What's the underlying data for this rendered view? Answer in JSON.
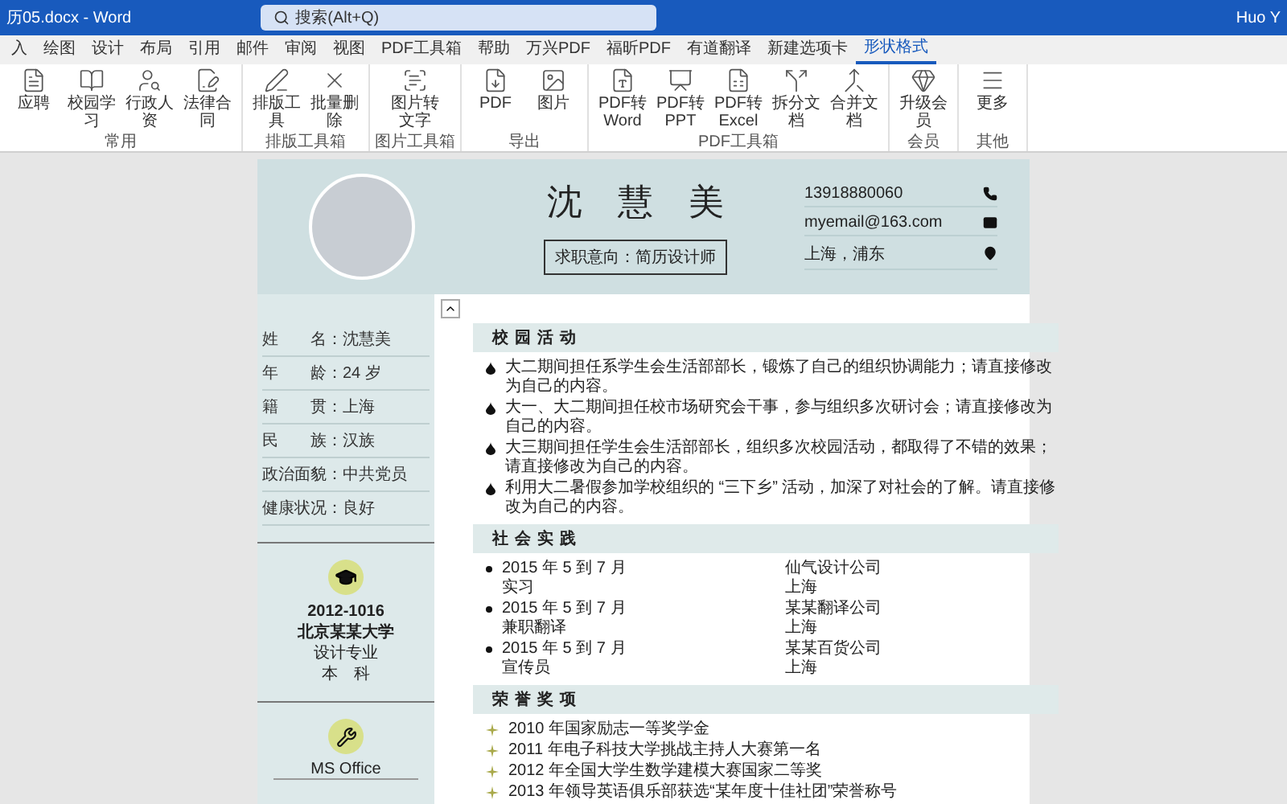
{
  "window": {
    "title": "历05.docx - Word",
    "search_placeholder": "搜索(Alt+Q)",
    "user": "Huo Y"
  },
  "tabs": [
    {
      "label": "入",
      "selected": false
    },
    {
      "label": "绘图",
      "selected": false
    },
    {
      "label": "设计",
      "selected": false
    },
    {
      "label": "布局",
      "selected": false
    },
    {
      "label": "引用",
      "selected": false
    },
    {
      "label": "邮件",
      "selected": false
    },
    {
      "label": "审阅",
      "selected": false
    },
    {
      "label": "视图",
      "selected": false
    },
    {
      "label": "PDF工具箱",
      "selected": false
    },
    {
      "label": "帮助",
      "selected": false
    },
    {
      "label": "万兴PDF",
      "selected": false
    },
    {
      "label": "福昕PDF",
      "selected": false
    },
    {
      "label": "有道翻译",
      "selected": false
    },
    {
      "label": "新建选项卡",
      "selected": false
    },
    {
      "label": "形状格式",
      "selected": true
    }
  ],
  "ribbon_groups": [
    {
      "label": "常用",
      "buttons": [
        "应聘",
        "校园学习",
        "行政人资",
        "法律合同"
      ]
    },
    {
      "label": "排版工具箱",
      "buttons": [
        "排版工具",
        "批量删除"
      ]
    },
    {
      "label": "图片工具箱",
      "buttons": [
        "图片转文字"
      ]
    },
    {
      "label": "导出",
      "buttons": [
        "PDF",
        "图片"
      ]
    },
    {
      "label": "PDF工具箱",
      "buttons": [
        "PDF转Word",
        "PDF转PPT",
        "PDF转Excel",
        "拆分文档",
        "合并文档"
      ]
    },
    {
      "label": "会员",
      "buttons": [
        "升级会员"
      ]
    },
    {
      "label": "其他",
      "buttons": [
        "更多"
      ]
    }
  ],
  "resume": {
    "name": "沈慧美",
    "objective": "求职意向：简历设计师",
    "contacts": [
      "13918880060",
      "myemail@163.com",
      "上海，浦东"
    ],
    "profile": [
      "姓　　名：沈慧美",
      "年　　龄：24 岁",
      "籍　　贯：上海",
      "民　　族：汉族",
      "政治面貌：中共党员",
      "健康状况：良好"
    ],
    "education": {
      "years": "2012-1016",
      "school": "北京某某大学",
      "major": "设计专业",
      "degree": "本　科"
    },
    "skills": [
      "MS Office"
    ],
    "campus": {
      "title": "校园活动",
      "items": [
        "大二期间担任系学生会生活部部长，锻炼了自己的组织协调能力；请直接修改为自己的内容。",
        "大一、大二期间担任校市场研究会干事，参与组织多次研讨会；请直接修改为自己的内容。",
        "大三期间担任学生会生活部部长，组织多次校园活动，都取得了不错的效果；请直接修改为自己的内容。",
        "利用大二暑假参加学校组织的 “三下乡” 活动，加深了对社会的了解。请直接修改为自己的内容。"
      ]
    },
    "practice": {
      "title": "社会实践",
      "items": [
        {
          "date": "2015 年 5 到 7 月",
          "role": "实习",
          "company": "仙气设计公司",
          "place": "上海"
        },
        {
          "date": "2015 年 5 到 7 月",
          "role": "兼职翻译",
          "company": "某某翻译公司",
          "place": "上海"
        },
        {
          "date": "2015 年 5 到 7 月",
          "role": "宣传员",
          "company": "某某百货公司",
          "place": "上海"
        }
      ]
    },
    "honors": {
      "title": "荣誉奖项",
      "items": [
        "2010 年国家励志一等奖学金",
        "2011 年电子科技大学挑战主持人大赛第一名",
        "2012 年全国大学生数学建模大赛国家二等奖",
        "2013 年领导英语俱乐部获选“某年度十佳社团”荣誉称号"
      ]
    }
  }
}
